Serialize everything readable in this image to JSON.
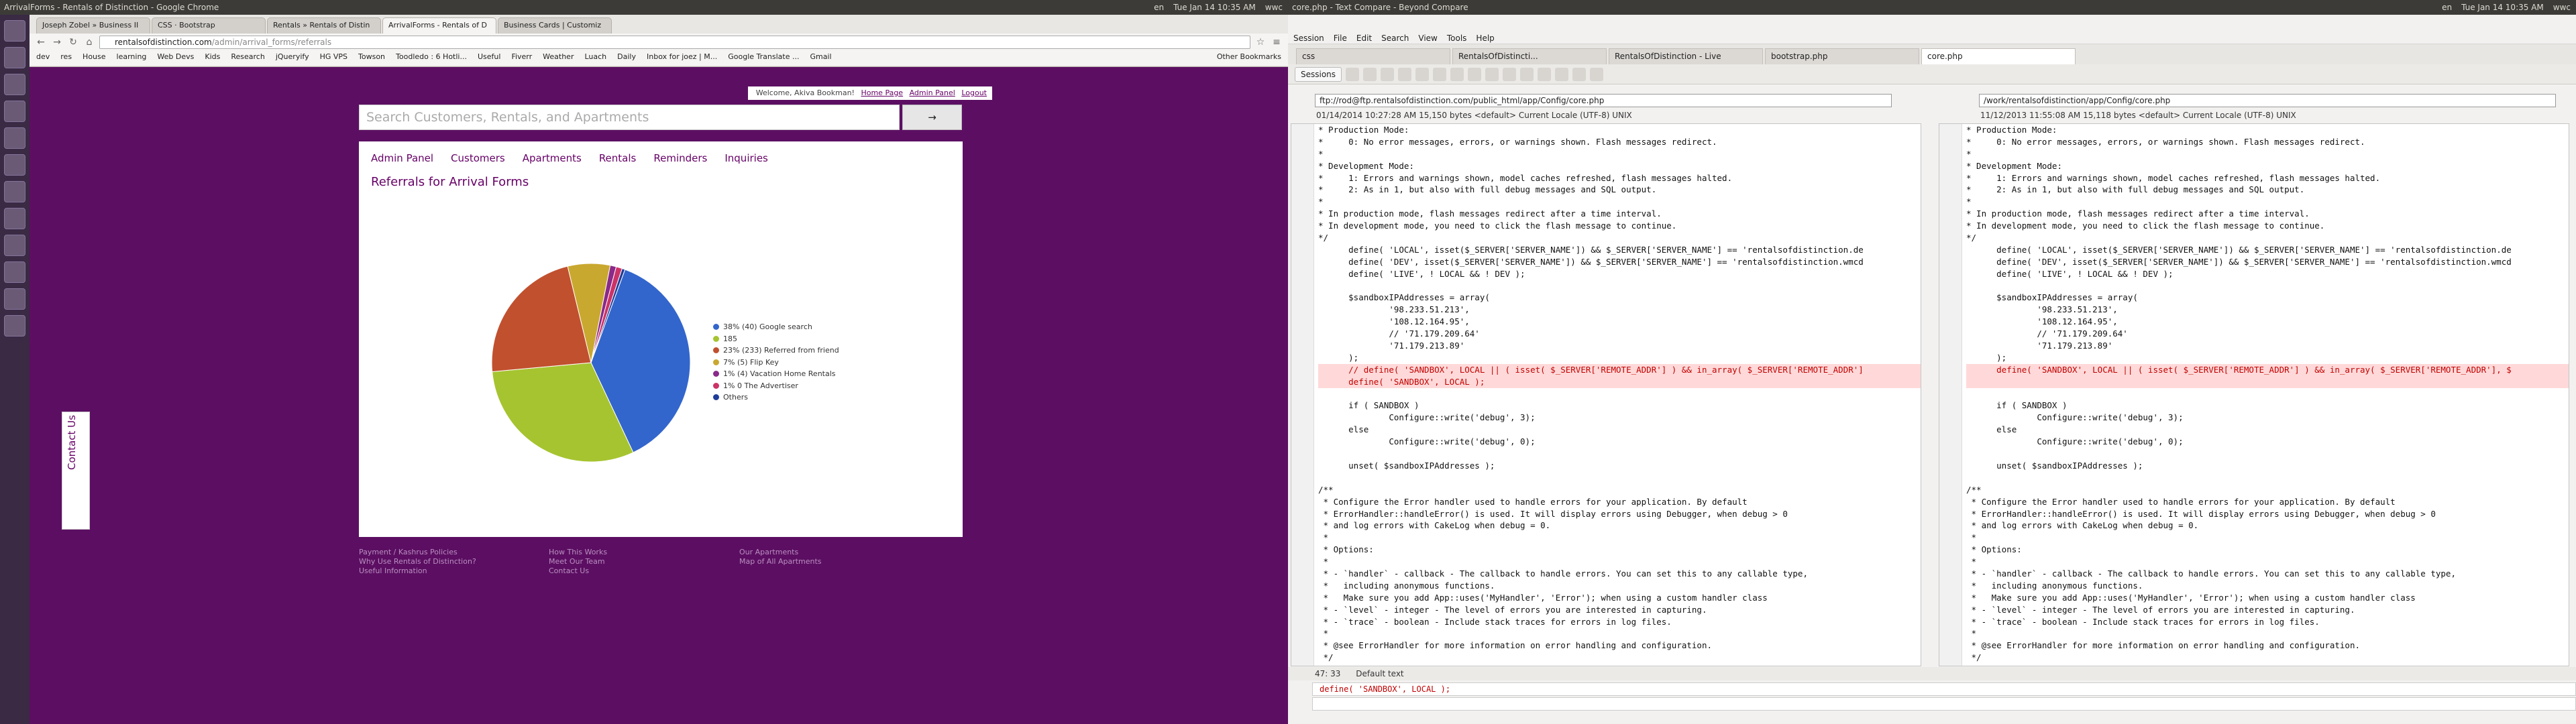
{
  "left": {
    "topbar": {
      "title": "ArrivalForms - Rentals of Distinction - Google Chrome",
      "right": [
        "en",
        "Tue Jan 14 10:35 AM",
        "wwc"
      ]
    },
    "tabs": [
      "Joseph Zobel » Business II",
      "CSS · Bootstrap",
      "Rentals » Rentals of Distin",
      "ArrivalForms - Rentals of D",
      "Business Cards | Customiz"
    ],
    "url": {
      "host": "rentalsofdistinction.com",
      "path": "/admin/arrival_forms/referrals"
    },
    "bookmarks": [
      "dev",
      "res",
      "House",
      "learning",
      "Web Devs",
      "Kids",
      "Research",
      "jQueryify",
      "HG VPS",
      "Towson",
      "Toodledo : 6 Hotli...",
      "Useful",
      "Fiverr",
      "Weather",
      "Luach",
      "Daily",
      "Inbox for joez | M...",
      "Google Translate ...",
      "Gmail"
    ],
    "bookmarks_other": "Other Bookmarks",
    "welcome": {
      "text": "Welcome, Akiva Bookman!",
      "home": "Home Page",
      "admin": "Admin Panel",
      "logout": "Logout"
    },
    "search": {
      "placeholder": "Search Customers, Rentals, and Apartments",
      "button": "→"
    },
    "menu": [
      "Admin Panel",
      "Customers",
      "Apartments",
      "Rentals",
      "Reminders",
      "Inquiries"
    ],
    "heading": "Referrals for Arrival Forms",
    "contact": "Contact Us",
    "footer": {
      "col1": [
        "Payment / Kashrus Policies",
        "Why Use Rentals of Distinction?",
        "Useful Information"
      ],
      "col2": [
        "How This Works",
        "Meet Our Team",
        "Contact Us"
      ],
      "col3": [
        "Our Apartments",
        "Map of All Apartments"
      ]
    }
  },
  "chart_data": {
    "type": "pie",
    "series": [
      {
        "name": "38% (40) Google search",
        "value": 38,
        "color": "#3366cc"
      },
      {
        "name": "185",
        "value": 31,
        "color": "#a6c430"
      },
      {
        "name": "23% (233) Referred from friend",
        "value": 23,
        "color": "#c1502e"
      },
      {
        "name": "7% (5) Flip Key",
        "value": 7,
        "color": "#c9a830"
      },
      {
        "name": "1% (4) Vacation Home Rentals",
        "value": 1,
        "color": "#8a2a8a"
      },
      {
        "name": "1% 0 The Advertiser",
        "value": 1,
        "color": "#cc3366"
      },
      {
        "name": "Others",
        "value": 0.5,
        "color": "#1f3d99"
      }
    ]
  },
  "right": {
    "topbar": {
      "title": "core.php - Text Compare - Beyond Compare",
      "right": [
        "en",
        "Tue Jan 14 10:35 AM",
        "wwc"
      ]
    },
    "menubar": [
      "Session",
      "File",
      "Edit",
      "Search",
      "View",
      "Tools",
      "Help"
    ],
    "tabs": [
      "css",
      "RentalsOfDistincti...",
      "RentalsOfDistinction - Live",
      "bootstrap.php",
      "core.php"
    ],
    "sessions_label": "Sessions",
    "left_path": "ftp://rod@ftp.rentalsofdistinction.com/public_html/app/Config/core.php",
    "right_path": "/work/rentalsofdistinction/app/Config/core.php",
    "left_info": "01/14/2014 10:27:28 AM   15,150 bytes   <default>   Current Locale (UTF-8)   UNIX",
    "right_info": "11/12/2013 11:55:08 AM   15,118 bytes   <default>   Current Locale (UTF-8)   UNIX",
    "left_code": [
      "* Production Mode:",
      "*     0: No error messages, errors, or warnings shown. Flash messages redirect.",
      "*",
      "* Development Mode:",
      "*     1: Errors and warnings shown, model caches refreshed, flash messages halted.",
      "*     2: As in 1, but also with full debug messages and SQL output.",
      "*",
      "* In production mode, flash messages redirect after a time interval.",
      "* In development mode, you need to click the flash message to continue.",
      "*/",
      "      define( 'LOCAL', isset($_SERVER['SERVER_NAME']) && $_SERVER['SERVER_NAME'] == 'rentalsofdistinction.de",
      "      define( 'DEV', isset($_SERVER['SERVER_NAME']) && $_SERVER['SERVER_NAME'] == 'rentalsofdistinction.wmcd",
      "      define( 'LIVE', ! LOCAL && ! DEV );",
      "",
      "      $sandboxIPAddresses = array(",
      "              '98.233.51.213',",
      "              '108.12.164.95',",
      "              // '71.179.209.64'",
      "              '71.179.213.89'",
      "      );",
      "      // define( 'SANDBOX', LOCAL || ( isset( $_SERVER['REMOTE_ADDR'] ) && in_array( $_SERVER['REMOTE_ADDR']",
      "      define( 'SANDBOX', LOCAL );",
      "",
      "      if ( SANDBOX )",
      "              Configure::write('debug', 3);",
      "      else",
      "              Configure::write('debug', 0);",
      "",
      "      unset( $sandboxIPAddresses );",
      "",
      "/**",
      " * Configure the Error handler used to handle errors for your application. By default",
      " * ErrorHandler::handleError() is used. It will display errors using Debugger, when debug > 0",
      " * and log errors with CakeLog when debug = 0.",
      " *",
      " * Options:",
      " *",
      " * - `handler` - callback - The callback to handle errors. You can set this to any callable type,",
      " *   including anonymous functions.",
      " *   Make sure you add App::uses('MyHandler', 'Error'); when using a custom handler class",
      " * - `level` - integer - The level of errors you are interested in capturing.",
      " * - `trace` - boolean - Include stack traces for errors in log files.",
      " *",
      " * @see ErrorHandler for more information on error handling and configuration.",
      " */"
    ],
    "right_code": [
      "* Production Mode:",
      "*     0: No error messages, errors, or warnings shown. Flash messages redirect.",
      "*",
      "* Development Mode:",
      "*     1: Errors and warnings shown, model caches refreshed, flash messages halted.",
      "*     2: As in 1, but also with full debug messages and SQL output.",
      "*",
      "* In production mode, flash messages redirect after a time interval.",
      "* In development mode, you need to click the flash message to continue.",
      "*/",
      "      define( 'LOCAL', isset($_SERVER['SERVER_NAME']) && $_SERVER['SERVER_NAME'] == 'rentalsofdistinction.de",
      "      define( 'DEV', isset($_SERVER['SERVER_NAME']) && $_SERVER['SERVER_NAME'] == 'rentalsofdistinction.wmcd",
      "      define( 'LIVE', ! LOCAL && ! DEV );",
      "",
      "      $sandboxIPAddresses = array(",
      "              '98.233.51.213',",
      "              '108.12.164.95',",
      "              // '71.179.209.64'",
      "              '71.179.213.89'",
      "      );",
      "      define( 'SANDBOX', LOCAL || ( isset( $_SERVER['REMOTE_ADDR'] ) && in_array( $_SERVER['REMOTE_ADDR'], $",
      "",
      "",
      "      if ( SANDBOX )",
      "              Configure::write('debug', 3);",
      "      else",
      "              Configure::write('debug', 0);",
      "",
      "      unset( $sandboxIPAddresses );",
      "",
      "/**",
      " * Configure the Error handler used to handle errors for your application. By default",
      " * ErrorHandler::handleError() is used. It will display errors using Debugger, when debug > 0",
      " * and log errors with CakeLog when debug = 0.",
      " *",
      " * Options:",
      " *",
      " * - `handler` - callback - The callback to handle errors. You can set this to any callable type,",
      " *   including anonymous functions.",
      " *   Make sure you add App::uses('MyHandler', 'Error'); when using a custom handler class",
      " * - `level` - integer - The level of errors you are interested in capturing.",
      " * - `trace` - boolean - Include stack traces for errors in log files.",
      " *",
      " * @see ErrorHandler for more information on error handling and configuration.",
      " */"
    ],
    "diff_lines": [
      20,
      21
    ],
    "status": {
      "position": "47: 33",
      "mode": "Default text"
    },
    "bottom_line": "define( 'SANDBOX', LOCAL );"
  }
}
